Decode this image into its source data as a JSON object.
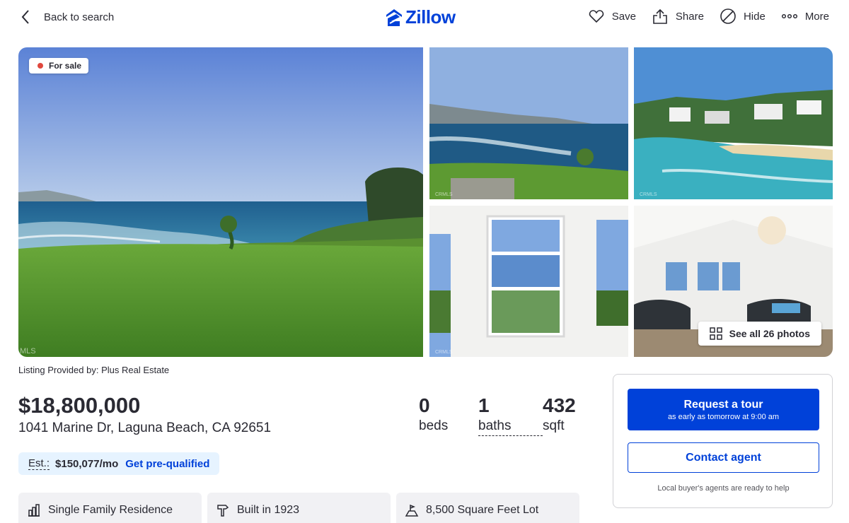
{
  "header": {
    "back_label": "Back to search",
    "logo_text": "Zillow",
    "actions": {
      "save": "Save",
      "share": "Share",
      "hide": "Hide",
      "more": "More"
    }
  },
  "gallery": {
    "status_badge": "For sale",
    "see_all": "See all 26 photos",
    "watermark_main": "MLS",
    "watermark_thumb": "CRMLS"
  },
  "listing": {
    "provided_by": "Listing Provided by: Plus Real Estate",
    "price": "$18,800,000",
    "address": "1041 Marine Dr, Laguna Beach, CA 92651",
    "beds": {
      "value": "0",
      "label": "beds"
    },
    "baths": {
      "value": "1",
      "label": "baths"
    },
    "sqft": {
      "value": "432",
      "label": "sqft"
    },
    "estimate": {
      "label": "Est.:",
      "value": "$150,077/mo",
      "link": "Get pre-qualified"
    },
    "facts": [
      {
        "icon": "building-icon",
        "text": "Single Family Residence"
      },
      {
        "icon": "hammer-icon",
        "text": "Built in 1923"
      },
      {
        "icon": "lot-icon",
        "text": "8,500 Square Feet Lot"
      }
    ]
  },
  "contact": {
    "tour_title": "Request a tour",
    "tour_sub": "as early as tomorrow at 9:00 am",
    "contact_agent": "Contact agent",
    "note": "Local buyer's agents are ready to help"
  },
  "colors": {
    "brand": "#0041d9",
    "text": "#2a2a33",
    "est_bg": "#e6f3ff",
    "fact_bg": "#f1f1f4",
    "for_sale_dot": "#e0483e"
  }
}
